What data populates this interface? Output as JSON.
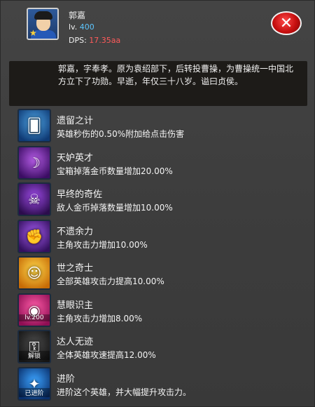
{
  "hero": {
    "name": "郭嘉",
    "level_prefix": "lv.",
    "level": "400",
    "dps_label": "DPS:",
    "dps_value": "17.35aa",
    "description": "郭嘉，字奉孝。原为袁绍部下，后转投曹操，为曹操统一中国北方立下了功勋。早逝，年仅三十八岁。谥曰贞侯。",
    "portrait_icon": "hero-portrait-icon"
  },
  "skills": [
    {
      "name": "遗留之计",
      "effect": "英雄秒伤的0.50%附加给点击伤害",
      "icon": "card-hand-icon",
      "colors": [
        "#4ea5e6",
        "#0f3a74"
      ]
    },
    {
      "name": "天妒英才",
      "effect": "宝箱掉落金币数量增加20.00%",
      "icon": "scythe-icon",
      "colors": [
        "#b45be5",
        "#3b0d63"
      ]
    },
    {
      "name": "早终的奇佐",
      "effect": "敌人金币掉落数量增加10.00%",
      "icon": "demon-icon",
      "colors": [
        "#9d4ae6",
        "#2b0c4c"
      ]
    },
    {
      "name": "不遗余力",
      "effect": "主角攻击力增加10.00%",
      "icon": "fist-icon",
      "colors": [
        "#a45bf0",
        "#33105d"
      ]
    },
    {
      "name": "世之奇士",
      "effect": "全部英雄攻击力提高10.00%",
      "icon": "people-icon",
      "colors": [
        "#ffd84a",
        "#c66b06"
      ]
    },
    {
      "name": "慧眼识主",
      "effect": "主角攻击力增加8.00%",
      "icon": "eye-icon",
      "colors": [
        "#ff5ba8",
        "#8e0e53"
      ],
      "badge": "lv.200"
    },
    {
      "name": "达人无迹",
      "effect": "全体英雄攻速提高12.00%",
      "icon": "lock-icon",
      "colors": [
        "#4b4b4b",
        "#151515"
      ],
      "badge": "解锁"
    },
    {
      "name": "进阶",
      "effect": "进阶这个英雄，并大幅提升攻击力。",
      "icon": "evolve-icon",
      "colors": [
        "#3ba3ff",
        "#0a2f6b"
      ],
      "badge": "已进阶"
    }
  ],
  "close_icon": "close-icon"
}
